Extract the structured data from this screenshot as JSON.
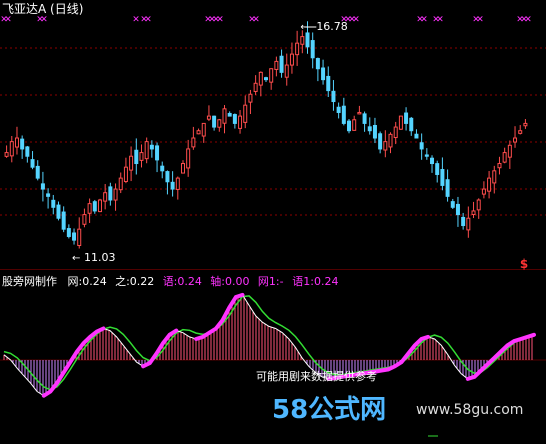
{
  "upper_panel": {
    "title": "飞亚达A (日线)",
    "high_label": "16.78",
    "low_label": "11.03",
    "marker_glyph": "✕",
    "dollar_glyph": "$",
    "colors": {
      "up": "#ff4d4d",
      "down": "#55d4ff",
      "grid": "#8b0000",
      "marker": "#ff33ff",
      "text": "#ffffff",
      "dollar": "#ff3333"
    }
  },
  "lower_panel": {
    "header": [
      {
        "text": "股旁网制作",
        "color": "#ffffff"
      },
      {
        "text": "网:0.24",
        "color": "#ffffff"
      },
      {
        "text": "之:0.22",
        "color": "#ffffff"
      },
      {
        "text": "语:0.24",
        "color": "#ff33ff"
      },
      {
        "text": "轴:0.00",
        "color": "#ff33ff"
      },
      {
        "text": "网1:-",
        "color": "#ff33ff"
      },
      {
        "text": "语1:0.24",
        "color": "#ff33ff"
      }
    ],
    "footnote": "可能用剧来数据提供参考",
    "colors": {
      "pos_bar": "#ff5577",
      "neg_bar": "#cc88ff",
      "line_fast": "#ffffff",
      "line_slow": "#33dd33",
      "highlight": "#ff33ff"
    }
  },
  "watermark": {
    "brand": "58公式网",
    "url": "www.58gu.com"
  },
  "chart_data": [
    {
      "type": "candlestick",
      "title": "飞亚达A (日线)",
      "annotations": [
        {
          "label": "16.78",
          "value": 16.78,
          "kind": "period-high"
        },
        {
          "label": "11.03",
          "value": 11.03,
          "kind": "period-low"
        }
      ],
      "ylim": [
        10.6,
        17.4
      ],
      "note": "closing-price path approximated from the candlestick shape",
      "close": [
        13.6,
        13.9,
        14.0,
        13.7,
        13.5,
        13.2,
        12.9,
        12.6,
        12.4,
        12.1,
        11.8,
        11.5,
        11.3,
        11.2,
        11.5,
        11.9,
        12.2,
        12.0,
        12.3,
        12.5,
        12.3,
        12.6,
        12.9,
        13.2,
        13.5,
        13.3,
        13.6,
        13.9,
        13.7,
        13.4,
        13.1,
        12.8,
        12.6,
        12.9,
        13.3,
        13.7,
        14.0,
        14.2,
        14.4,
        14.6,
        14.3,
        14.5,
        14.8,
        14.6,
        14.4,
        14.6,
        14.9,
        15.2,
        15.5,
        15.8,
        15.6,
        15.9,
        16.1,
        15.8,
        16.0,
        16.3,
        16.6,
        16.78,
        16.5,
        16.2,
        15.9,
        15.6,
        15.3,
        15.0,
        14.7,
        14.4,
        14.2,
        14.5,
        14.7,
        14.4,
        14.2,
        14.0,
        13.7,
        13.9,
        14.1,
        14.3,
        14.6,
        14.4,
        14.2,
        14.0,
        13.7,
        13.5,
        13.3,
        13.0,
        12.7,
        12.4,
        12.1,
        11.9,
        11.6,
        11.8,
        12.0,
        12.3,
        12.6,
        12.9,
        13.1,
        13.3,
        13.6,
        13.8,
        14.0,
        14.2,
        14.4
      ],
      "markers": {
        "glyph": "✕",
        "index_groups": [
          [
            0,
            1
          ],
          [
            9,
            10
          ],
          [
            33
          ],
          [
            35,
            36
          ],
          [
            51,
            52,
            53,
            54
          ],
          [
            62,
            63
          ],
          [
            85,
            86,
            87,
            88
          ],
          [
            104,
            105
          ],
          [
            108,
            109
          ],
          [
            118,
            119
          ],
          [
            129,
            130,
            131
          ]
        ]
      }
    },
    {
      "type": "line",
      "title": "股旁网制作",
      "series": [
        {
          "name": "网",
          "last": 0.24
        },
        {
          "name": "之",
          "last": 0.22
        },
        {
          "name": "语",
          "last": 0.24
        },
        {
          "name": "轴",
          "last": 0.0
        },
        {
          "name": "网1",
          "last": null
        },
        {
          "name": "语1",
          "last": 0.24
        }
      ],
      "ylim": [
        -0.4,
        0.7
      ],
      "note": "oscillator path approximated from the drawn curves",
      "fast": [
        0.05,
        0.0,
        -0.08,
        -0.15,
        -0.22,
        -0.3,
        -0.34,
        -0.3,
        -0.22,
        -0.12,
        -0.02,
        0.08,
        0.16,
        0.22,
        0.27,
        0.3,
        0.28,
        0.22,
        0.14,
        0.06,
        -0.02,
        -0.06,
        -0.03,
        0.06,
        0.16,
        0.24,
        0.28,
        0.26,
        0.22,
        0.2,
        0.22,
        0.26,
        0.3,
        0.38,
        0.5,
        0.6,
        0.62,
        0.52,
        0.42,
        0.36,
        0.32,
        0.3,
        0.26,
        0.2,
        0.12,
        0.02,
        -0.06,
        -0.12,
        -0.16,
        -0.18,
        -0.17,
        -0.16,
        -0.15,
        -0.14,
        -0.13,
        -0.12,
        -0.11,
        -0.1,
        -0.09,
        -0.06,
        -0.02,
        0.06,
        0.14,
        0.2,
        0.22,
        0.2,
        0.14,
        0.05,
        -0.05,
        -0.13,
        -0.18,
        -0.16,
        -0.1,
        -0.04,
        0.02,
        0.08,
        0.14,
        0.18,
        0.2,
        0.22,
        0.24
      ]
    }
  ]
}
